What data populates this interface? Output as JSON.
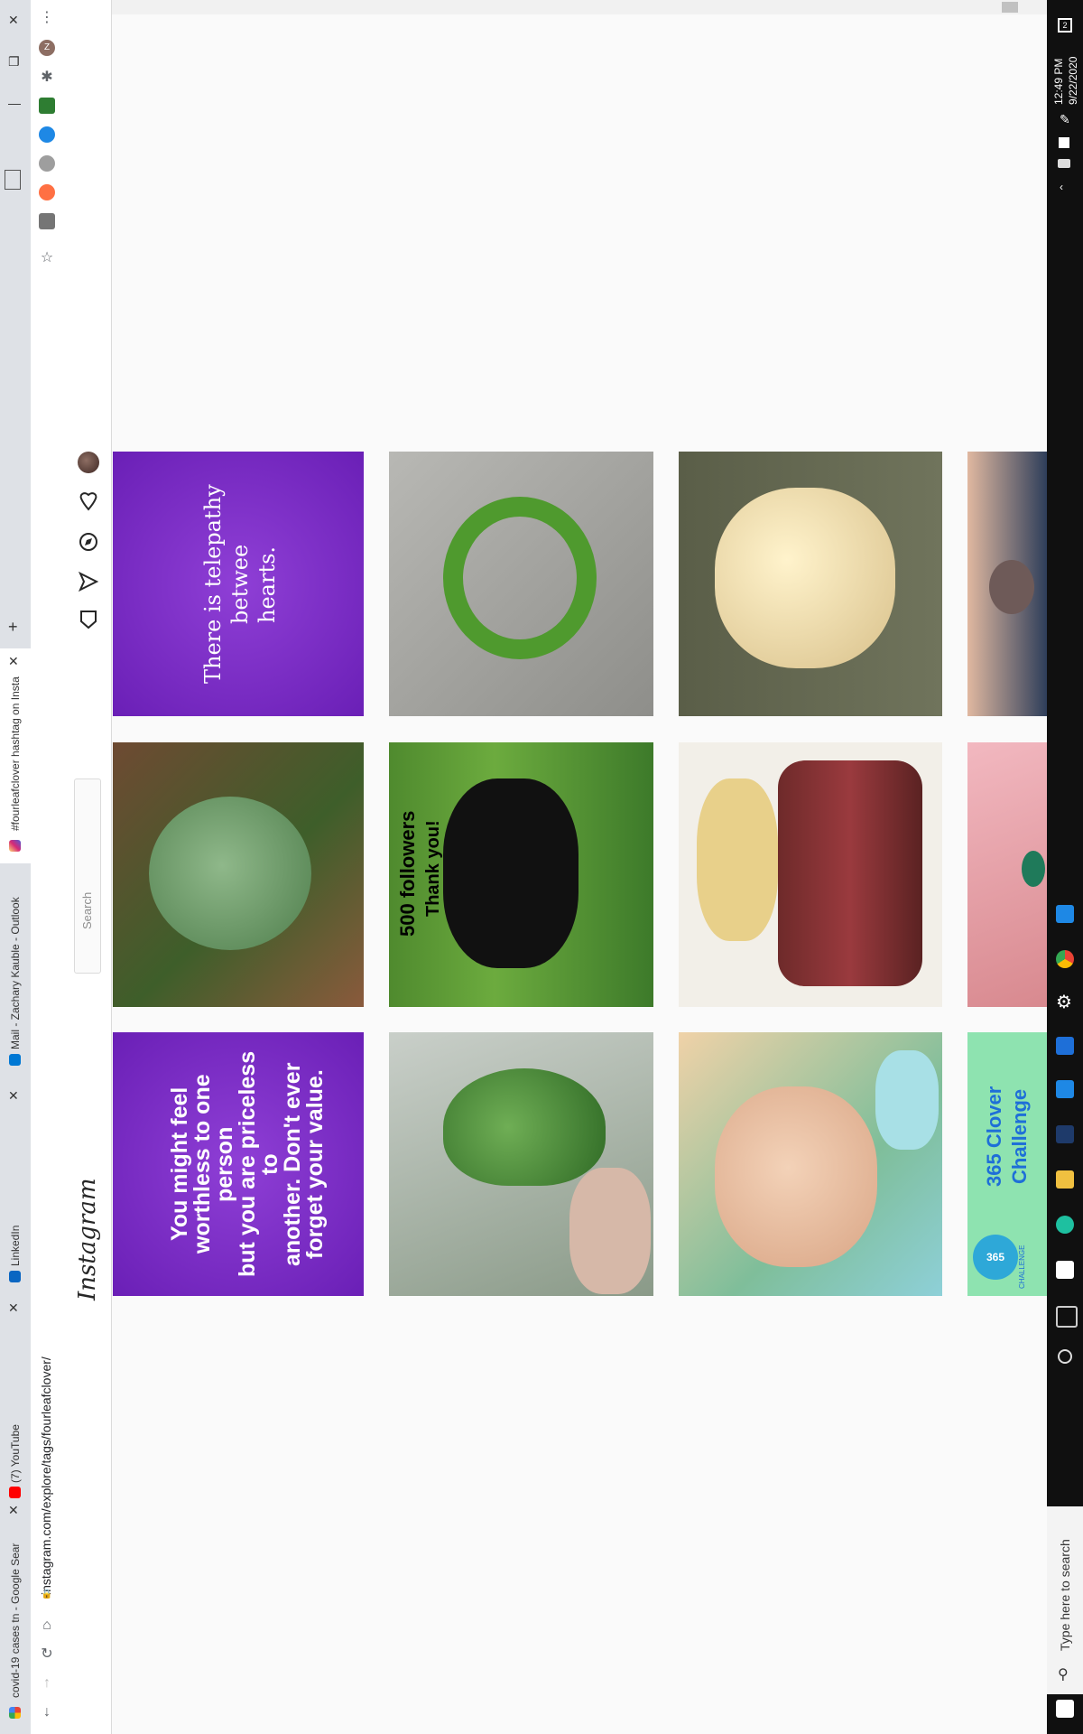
{
  "window_controls": {
    "close": "✕",
    "restore": "❐",
    "minimize": "—"
  },
  "tabs": [
    {
      "label": "covid-19 cases tn - Google Sear",
      "icon": "google-icon"
    },
    {
      "label": "(7) YouTube",
      "icon": "youtube-icon"
    },
    {
      "label": "LinkedIn",
      "icon": "linkedin-icon"
    },
    {
      "label": "Mail - Zachary Kauble - Outlook",
      "icon": "outlook-icon"
    },
    {
      "label": "#fourleafclover hashtag on Insta",
      "icon": "instagram-icon"
    }
  ],
  "new_tab": "+",
  "toolbar": {
    "url": "instagram.com/explore/tags/fourleafclover/",
    "profile_initial": "Z",
    "menu": "⋮",
    "star": "☆"
  },
  "instagram": {
    "logo": "Instagram",
    "search_placeholder": "Search"
  },
  "posts": [
    {
      "row": 1,
      "col": 1,
      "text": "You might feel\nworthless to one person\nbut you are priceless to\nanother. Don't ever\nforget your value.",
      "kind": "quote-purple"
    },
    {
      "row": 1,
      "col": 2,
      "text": "",
      "kind": "clover-leaf-photo"
    },
    {
      "row": 1,
      "col": 3,
      "text": "There is telepathy betwee\nhearts.",
      "kind": "quote-purple"
    },
    {
      "row": 2,
      "col": 1,
      "text": "",
      "kind": "clover-hand-photo"
    },
    {
      "row": 2,
      "col": 2,
      "text_a": "500 followers",
      "text_b": "Thank you!",
      "kind": "dog-photo"
    },
    {
      "row": 2,
      "col": 3,
      "text": "",
      "kind": "clover-ring-photo"
    },
    {
      "row": 3,
      "col": 1,
      "text": "",
      "kind": "child-photo"
    },
    {
      "row": 3,
      "col": 2,
      "text": "",
      "kind": "food-photo"
    },
    {
      "row": 3,
      "col": 3,
      "text": "",
      "kind": "gold-clover-photo"
    },
    {
      "row": 4,
      "col": 1,
      "text": "365 Clover Challenge",
      "badge": "365",
      "badge_sub": "CHALLENGE",
      "kind": "challenge-banner"
    },
    {
      "row": 4,
      "col": 2,
      "text": "",
      "kind": "jewelry-photo"
    },
    {
      "row": 4,
      "col": 3,
      "text": "",
      "kind": "tattoo-photo"
    }
  ],
  "taskbar": {
    "search_placeholder": "Type here to search",
    "time": "12:49 PM",
    "date": "9/22/2020",
    "notification_count": "2"
  }
}
